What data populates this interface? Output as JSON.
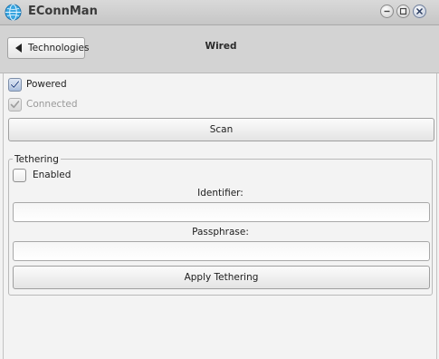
{
  "window": {
    "title": "EConnMan",
    "controls": [
      "minimize-icon",
      "maximize-icon",
      "close-icon"
    ]
  },
  "header": {
    "back_label": "Technologies",
    "title": "Wired"
  },
  "wired": {
    "powered_label": "Powered",
    "powered_checked": true,
    "connected_label": "Connected",
    "connected_checked": true,
    "connected_disabled": true,
    "scan_label": "Scan"
  },
  "tethering": {
    "legend": "Tethering",
    "enabled_label": "Enabled",
    "enabled_checked": false,
    "identifier_label": "Identifier:",
    "identifier_value": "",
    "passphrase_label": "Passphrase:",
    "passphrase_value": "",
    "apply_label": "Apply Tethering"
  },
  "colors": {
    "titlebar": "#c9c9c9",
    "header": "#d3d3d3",
    "content": "#f3f3f3",
    "check_accent": "#2a4a8a"
  }
}
